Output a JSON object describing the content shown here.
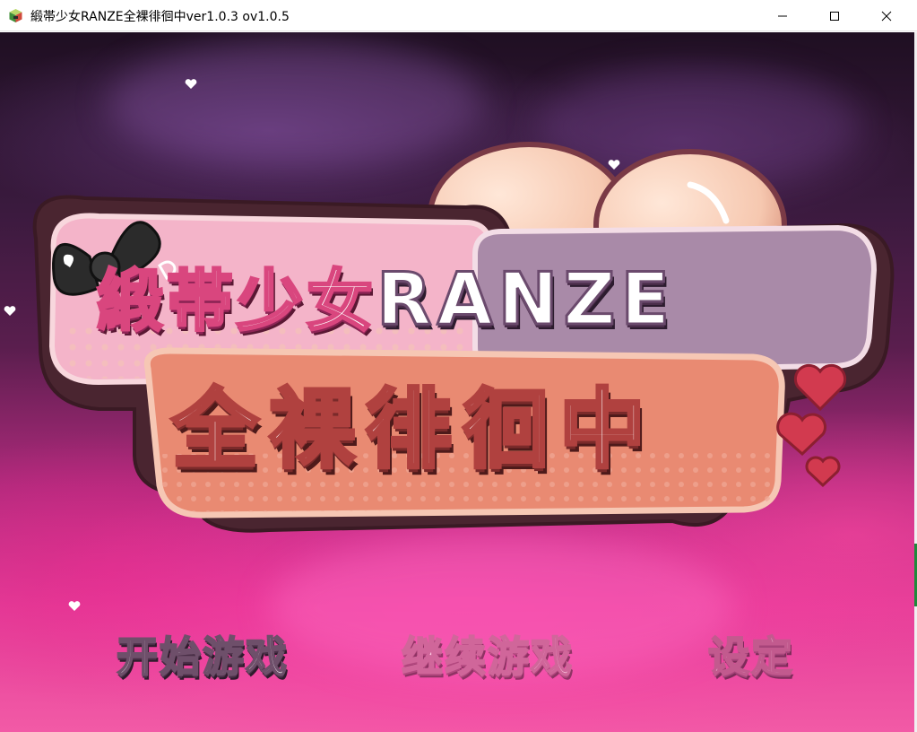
{
  "window": {
    "title": "緞帯少女RANZE全裸徘徊中ver1.0.3 ov1.0.5",
    "icons": {
      "app": "app-icon",
      "minimize": "minimize-icon",
      "maximize": "maximize-icon",
      "close": "close-icon"
    }
  },
  "game": {
    "logo": {
      "line1_cn": "緞帯少女",
      "line1_en": "RANZE",
      "line2": "全裸徘徊中"
    },
    "menu": {
      "start": "开始游戏",
      "continue": "继续游戏",
      "settings": "设定"
    },
    "colors": {
      "logo_pink_frame": "#f3b3c6",
      "logo_pink_text_stroke": "#d9467e",
      "logo_ranze_plate": "#a98aa8",
      "logo_line2_frame": "#e9876f",
      "background_top": "#1f0f22",
      "background_bottom": "#f25aa6"
    }
  }
}
